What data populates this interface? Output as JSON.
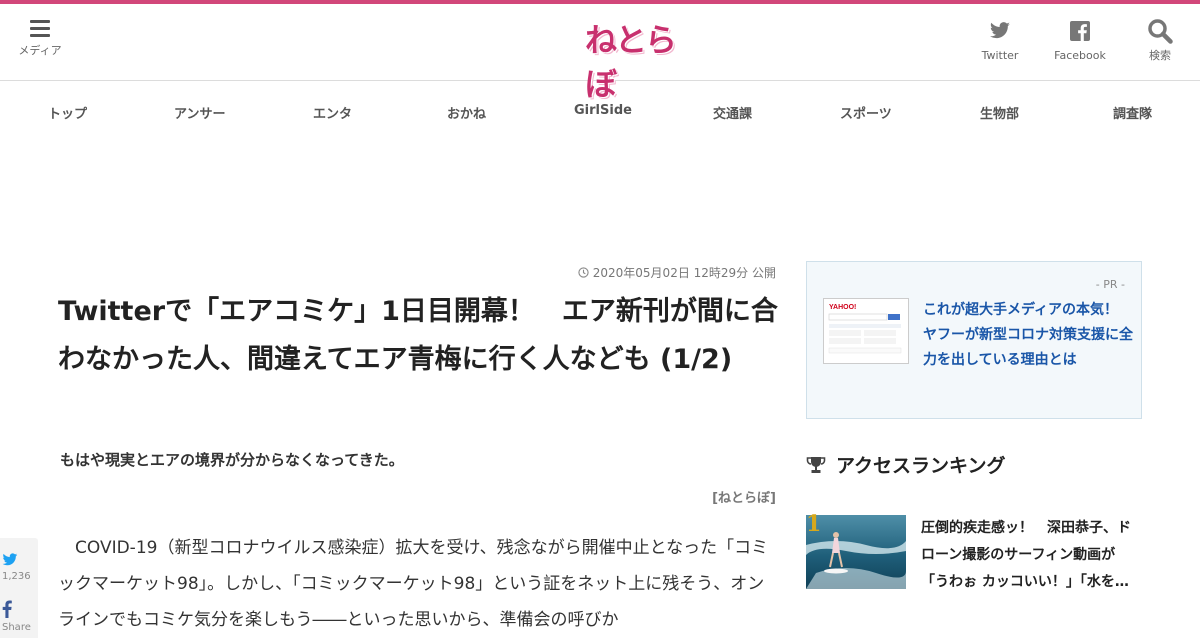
{
  "header": {
    "menu_label": "メディア",
    "logo_text": "ねとらぼ",
    "twitter_label": "Twitter",
    "facebook_label": "Facebook",
    "search_label": "検索",
    "accent_color": "#d2477a"
  },
  "nav": {
    "items": [
      "トップ",
      "アンサー",
      "エンタ",
      "おかね",
      "GirlSide",
      "交通課",
      "スポーツ",
      "生物部",
      "調査隊"
    ]
  },
  "article": {
    "date": "2020年05月02日 12時29分 公開",
    "title": "Twitterで「エアコミケ」1日目開幕！　エア新刊が間に合わなかった人、間違えてエア青梅に行く人なども (1/2)",
    "subtitle": "もはや現実とエアの境界が分からなくなってきた。",
    "credit": "[ねとらぼ]",
    "body": "　COVID-19（新型コロナウイルス感染症）拡大を受け、残念ながら開催中止となった「コミックマーケット98」。しかし、「コミックマーケット98」という証をネット上に残そう、オンラインでもコミケ気分を楽しもう――といった思いから、準備会の呼びか"
  },
  "share": {
    "twitter_count": "1,236",
    "facebook_label": "Share"
  },
  "sidebar": {
    "pr": {
      "label": "- PR -",
      "text": "これが超大手メディアの本気！　ヤフーが新型コロナ対策支援に全力を出している理由とは",
      "thumb_logo": "YAHOO!"
    },
    "ranking": {
      "heading": "アクセスランキング",
      "items": [
        {
          "rank": "1",
          "text": "圧倒的疾走感ッ！　深田恭子、ドローン撮影のサーフィン動画が「うわぉ カッコいい！」「水を…"
        }
      ]
    }
  }
}
